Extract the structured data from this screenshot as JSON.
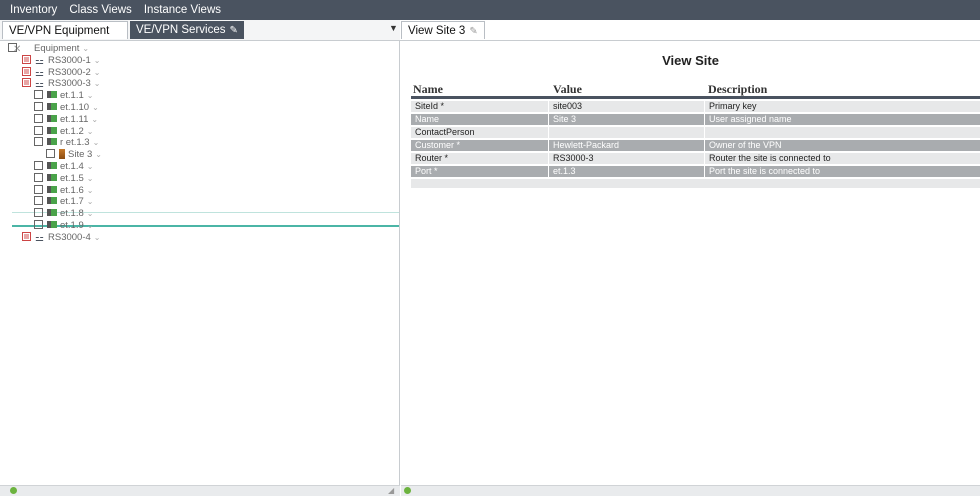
{
  "menu": [
    "Inventory",
    "Class Views",
    "Instance Views"
  ],
  "left_tabs": {
    "equipment": "VE/VPN Equipment",
    "services": "VE/VPN Services"
  },
  "right_tabs": {
    "view_site": "View Site 3"
  },
  "tree": [
    {
      "label": "Equipment",
      "icon": "equipment-icon"
    },
    {
      "label": "RS3000-1",
      "icon": "router-icon"
    },
    {
      "label": "RS3000-2",
      "icon": "router-icon"
    },
    {
      "label": "RS3000-3",
      "icon": "router-icon"
    },
    {
      "label": "et.1.1",
      "icon": "port-icon"
    },
    {
      "label": "et.1.10",
      "icon": "port-icon"
    },
    {
      "label": "et.1.11",
      "icon": "port-icon"
    },
    {
      "label": "et.1.2",
      "icon": "port-icon"
    },
    {
      "label": "r et.1.3",
      "icon": "port-icon"
    },
    {
      "label": "Site 3",
      "icon": "site-icon"
    },
    {
      "label": "et.1.4",
      "icon": "port-icon"
    },
    {
      "label": "et.1.5",
      "icon": "port-icon"
    },
    {
      "label": "et.1.6",
      "icon": "port-icon"
    },
    {
      "label": "et.1.7",
      "icon": "port-icon"
    },
    {
      "label": "et.1.8",
      "icon": "port-icon"
    },
    {
      "label": "et.1.9",
      "icon": "port-icon"
    },
    {
      "label": "RS3000-4",
      "icon": "router-icon"
    }
  ],
  "view": {
    "title": "View Site",
    "columns": [
      "Name",
      "Value",
      "Description"
    ],
    "rows": [
      {
        "name": "SiteId *",
        "value": "site003",
        "description": "Primary key"
      },
      {
        "name": "Name",
        "value": "Site 3",
        "description": "User assigned name"
      },
      {
        "name": "ContactPerson",
        "value": "",
        "description": ""
      },
      {
        "name": "Customer *",
        "value": "Hewlett-Packard",
        "description": "Owner of the VPN"
      },
      {
        "name": "Router *",
        "value": "RS3000-3",
        "description": "Router the site is connected to"
      },
      {
        "name": "Port *",
        "value": "et.1.3",
        "description": "Port the site is connected to"
      }
    ]
  },
  "colors": {
    "menubar": "#4a5360",
    "selection": "#4bb5a6",
    "status_ok": "#6cb33f"
  }
}
